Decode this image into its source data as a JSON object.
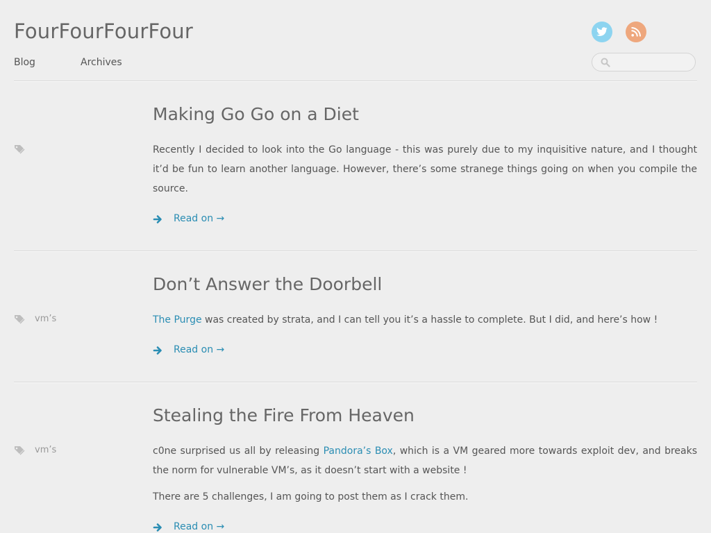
{
  "site": {
    "title": "FourFourFourFour"
  },
  "nav": {
    "items": [
      {
        "label": "Blog"
      },
      {
        "label": "Archives"
      }
    ]
  },
  "social": {
    "twitter_icon": "twitter-bird-icon",
    "rss_icon": "rss-feed-icon",
    "twitter_color": "#8dd4f0",
    "rss_color": "#eea77d"
  },
  "search": {
    "placeholder": "",
    "value": ""
  },
  "colors": {
    "background": "#eeeeee",
    "link": "#2a8db3",
    "text": "#555555",
    "title": "#666666"
  },
  "posts": [
    {
      "title": "Making Go Go on a Diet",
      "category": "",
      "excerpt": [
        "Recently I decided to look into the Go language - this was purely due to my inquisitive nature, and I thought it’d be fun to learn another language. However, there’s some stranege things going on when you compile the source."
      ],
      "read_on": "Read on →"
    },
    {
      "title": "Don’t Answer the Doorbell",
      "category": "vm’s",
      "excerpt_link": "The Purge",
      "excerpt_rest": " was created by strata, and I can tell you it’s a hassle to complete. But I did, and here’s how !",
      "read_on": "Read on →"
    },
    {
      "title": "Stealing the Fire From Heaven",
      "category": "vm’s",
      "excerpt_before": "c0ne surprised us all by releasing ",
      "excerpt_link": "Pandora’s Box",
      "excerpt_after": ", which is a VM geared more towards exploit dev, and breaks the norm for vulnerable VM’s, as it doesn’t start with a website !",
      "excerpt_second": "There are 5 challenges, I am going to post them as I crack them.",
      "read_on": "Read on →"
    }
  ]
}
